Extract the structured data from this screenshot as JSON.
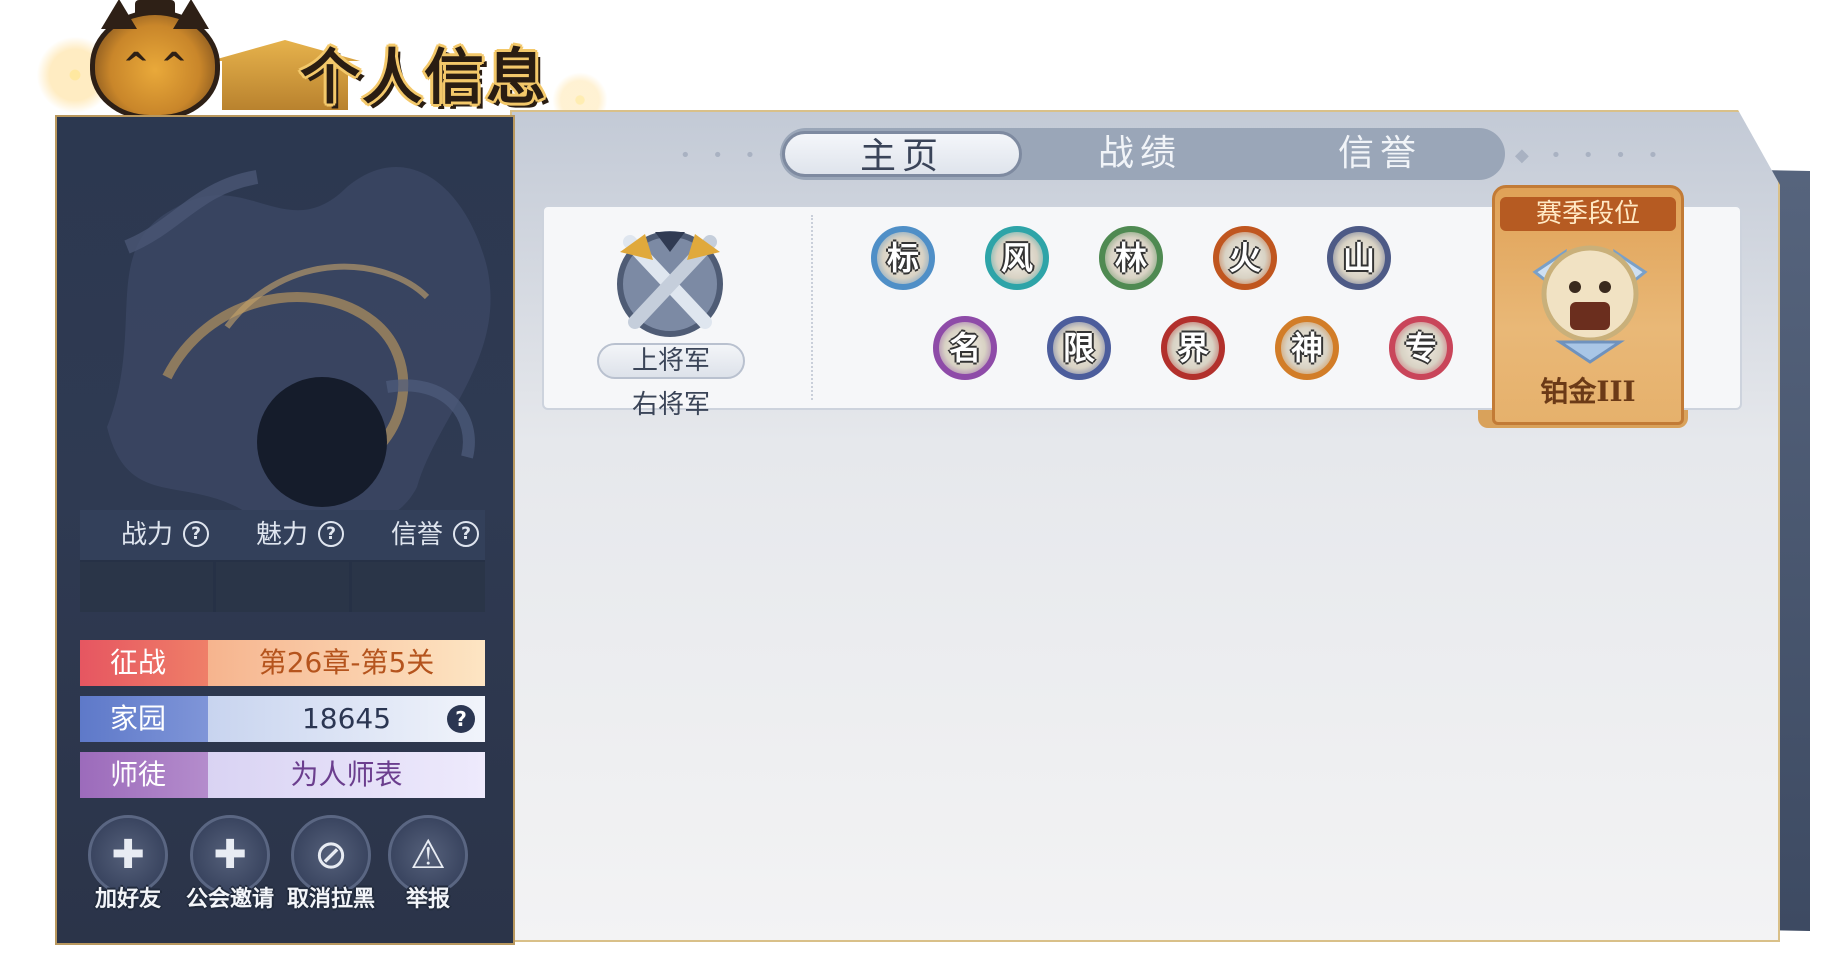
{
  "header": {
    "title": "个人信息"
  },
  "stats": [
    {
      "label": "战力"
    },
    {
      "label": "魅力"
    },
    {
      "label": "信誉"
    }
  ],
  "help_glyph": "?",
  "info_rows": {
    "conquest": {
      "label": "征战",
      "value": "第26章-第5关"
    },
    "home": {
      "label": "家园",
      "value": "18645"
    },
    "mentor": {
      "label": "师徒",
      "value": "为人师表"
    }
  },
  "actions": [
    {
      "label": "加好友",
      "icon": "cat-plus-icon"
    },
    {
      "label": "公会邀请",
      "icon": "cat-plus-icon"
    },
    {
      "label": "取消拉黑",
      "icon": "block-icon"
    },
    {
      "label": "举报",
      "icon": "warning-icon"
    }
  ],
  "tabs": [
    {
      "label": "主页",
      "active": true
    },
    {
      "label": "战绩",
      "active": false
    },
    {
      "label": "信誉",
      "active": false
    }
  ],
  "rank": {
    "title": "上将军",
    "subtitle": "右将军"
  },
  "badges": [
    {
      "char": "标",
      "color": "#4f8fc7"
    },
    {
      "char": "风",
      "color": "#2ea4a8"
    },
    {
      "char": "林",
      "color": "#4f8a52"
    },
    {
      "char": "火",
      "color": "#c0561f"
    },
    {
      "char": "山",
      "color": "#4d5a86"
    },
    {
      "char": "名",
      "color": "#8e4ba8"
    },
    {
      "char": "限",
      "color": "#4c5d9c"
    },
    {
      "char": "界",
      "color": "#b2302c"
    },
    {
      "char": "神",
      "color": "#d27d28"
    },
    {
      "char": "专",
      "color": "#c9455a"
    }
  ],
  "season": {
    "title": "赛季段位",
    "rank": "铂金III"
  },
  "colors": {
    "panel_dark": "#2c3850",
    "gold_border": "#b9985e",
    "season_orange": "#e0a257"
  }
}
